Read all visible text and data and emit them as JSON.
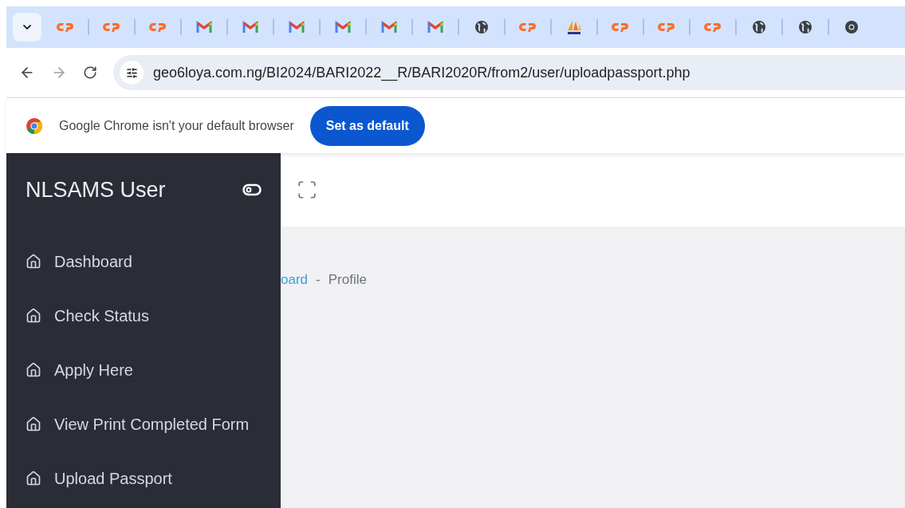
{
  "browser": {
    "tabs": [
      {
        "kind": "cpanel"
      },
      {
        "kind": "cpanel"
      },
      {
        "kind": "cpanel"
      },
      {
        "kind": "gmail"
      },
      {
        "kind": "gmail"
      },
      {
        "kind": "gmail"
      },
      {
        "kind": "gmail"
      },
      {
        "kind": "gmail"
      },
      {
        "kind": "gmail"
      },
      {
        "kind": "globe"
      },
      {
        "kind": "cpanel"
      },
      {
        "kind": "pma"
      },
      {
        "kind": "cpanel"
      },
      {
        "kind": "cpanel"
      },
      {
        "kind": "cpanel"
      },
      {
        "kind": "globe"
      },
      {
        "kind": "globe"
      },
      {
        "kind": "chrome"
      }
    ],
    "url": "geo6loya.com.ng/BI2024/BARI2022__R/BARI2020R/from2/user/uploadpassport.php",
    "infobar": {
      "message": "Google Chrome isn't your default browser",
      "button": "Set as default"
    }
  },
  "sidebar": {
    "title": "NLSAMS User",
    "items": [
      {
        "label": "Dashboard"
      },
      {
        "label": "Check Status"
      },
      {
        "label": "Apply Here"
      },
      {
        "label": "View Print Completed Form"
      },
      {
        "label": "Upload Passport"
      }
    ]
  },
  "breadcrumb": {
    "link": "oard",
    "separator": "-",
    "current": "Profile"
  }
}
